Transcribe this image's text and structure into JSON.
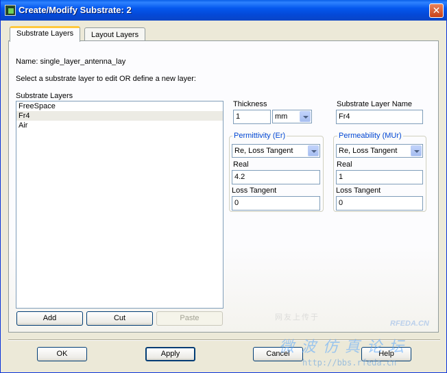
{
  "window": {
    "title": "Create/Modify Substrate: 2",
    "close_glyph": "✕"
  },
  "tabs": [
    {
      "label": "Substrate Layers",
      "active": true
    },
    {
      "label": "Layout Layers",
      "active": false
    }
  ],
  "name_line": "Name: single_layer_antenna_lay",
  "instruction": "Select a substrate layer to edit OR define a new layer:",
  "list": {
    "heading": "Substrate Layers",
    "items": [
      "FreeSpace",
      "Fr4",
      "Air"
    ],
    "selected": "Fr4"
  },
  "list_buttons": {
    "add": "Add",
    "cut": "Cut",
    "paste": "Paste"
  },
  "thickness": {
    "label": "Thickness",
    "value": "1",
    "unit": "mm"
  },
  "layer_name": {
    "label": "Substrate Layer Name",
    "value": "Fr4"
  },
  "permittivity": {
    "title": "Permittivity (Er)",
    "mode": "Re, Loss Tangent",
    "real_label": "Real",
    "real_value": "4.2",
    "loss_label": "Loss Tangent",
    "loss_value": "0"
  },
  "permeability": {
    "title": "Permeability (MUr)",
    "mode": "Re, Loss Tangent",
    "real_label": "Real",
    "real_value": "1",
    "loss_label": "Loss Tangent",
    "loss_value": "0"
  },
  "footer": {
    "ok": "OK",
    "apply": "Apply",
    "cancel": "Cancel",
    "help": "Help"
  },
  "watermark": {
    "top": "网友上传于",
    "logo": "RFEDA.CN",
    "cn": "微波仿真论坛",
    "url": "http://bbs.rfeda.cn"
  }
}
